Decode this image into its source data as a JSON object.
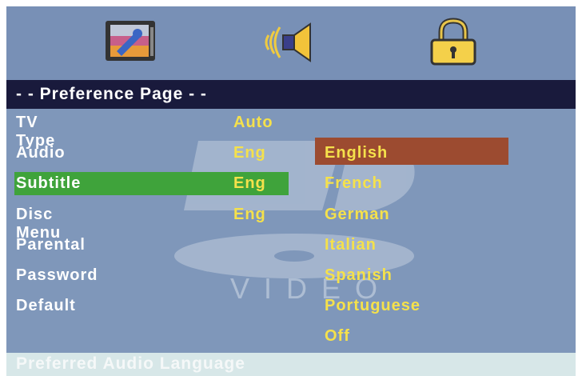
{
  "icons": [
    "tv-setup-icon",
    "speaker-icon",
    "padlock-icon"
  ],
  "header": {
    "title": "- - Preference Page - -"
  },
  "menu": [
    {
      "label": "TV Type",
      "value": "Auto"
    },
    {
      "label": "Audio",
      "value": "Eng"
    },
    {
      "label": "Subtitle",
      "value": "Eng"
    },
    {
      "label": "Disc Menu",
      "value": "Eng"
    },
    {
      "label": "Parental",
      "value": ""
    },
    {
      "label": "Password",
      "value": ""
    },
    {
      "label": "Default",
      "value": ""
    }
  ],
  "selected_item": "Subtitle",
  "options": [
    "English",
    "French",
    "German",
    "Italian",
    "Spanish",
    "Portuguese",
    "Off"
  ],
  "highlighted_option": "English",
  "background_text": "VIDEO",
  "footer": {
    "hint": "Preferred Audio Language"
  },
  "colors": {
    "screen_bg": "#7f97ba",
    "header_bg": "#191a3c",
    "selected_item_bg": "#3fa33b",
    "highlighted_option_bg": "#9c4b30",
    "value_text": "#f5e14b",
    "footer_bg": "#d7e7e8"
  }
}
